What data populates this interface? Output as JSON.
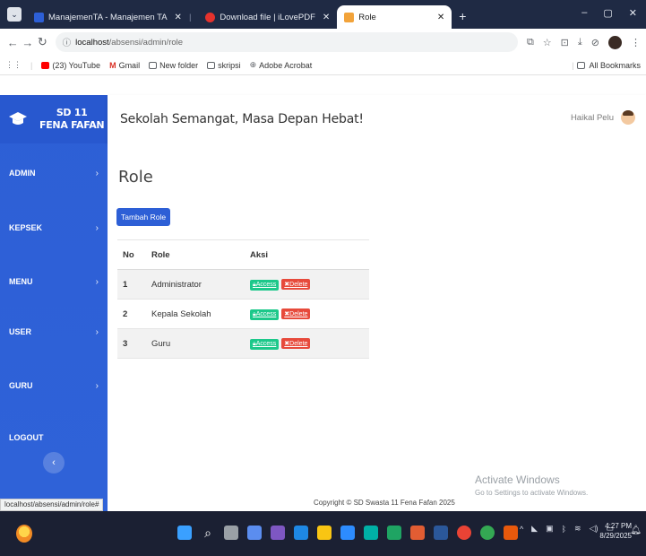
{
  "browser": {
    "tabs": [
      {
        "title": "ManajemenTA - Manajemen TA",
        "favicon_color": "#2d5fd6",
        "active": false
      },
      {
        "title": "Download file | iLovePDF",
        "favicon_color": "#e5322d",
        "active": false
      },
      {
        "title": "Role",
        "favicon_color": "#f2a33a",
        "active": true
      }
    ],
    "url_host": "localhost",
    "url_path": "/absensi/admin/role",
    "bookmarks": [
      {
        "label": "(23) YouTube",
        "icon_color": "#ff0000"
      },
      {
        "label": "Gmail",
        "icon_color": "#d93025"
      },
      {
        "label": "New folder",
        "icon_color": "#5f6368"
      },
      {
        "label": "skripsi",
        "icon_color": "#5f6368"
      },
      {
        "label": "Adobe Acrobat",
        "icon_color": "#5f6368"
      }
    ],
    "all_bookmarks": "All Bookmarks",
    "status_url": "localhost/absensi/admin/role#"
  },
  "sidebar": {
    "brand_line1": "SD 11",
    "brand_line2": "FENA FAFAN",
    "items": [
      {
        "label": "ADMIN",
        "has_chevron": true
      },
      {
        "label": "KEPSEK",
        "has_chevron": true
      },
      {
        "label": "MENU",
        "has_chevron": true
      },
      {
        "label": "USER",
        "has_chevron": true
      },
      {
        "label": "GURU",
        "has_chevron": true
      },
      {
        "label": "LOGOUT",
        "has_chevron": false
      }
    ],
    "toggle_label": "‹"
  },
  "topbar": {
    "motto": "Sekolah Semangat, Masa Depan Hebat!",
    "user_name": "Haikal Pelu"
  },
  "main": {
    "page_title": "Role",
    "add_button": "Tambah Role",
    "table": {
      "headers": [
        "No",
        "Role",
        "Aksi"
      ],
      "rows": [
        {
          "no": "1",
          "role": "Administrator",
          "access": "Access",
          "delete": "Delete"
        },
        {
          "no": "2",
          "role": "Kepala Sekolah",
          "access": "Access",
          "delete": "Delete"
        },
        {
          "no": "3",
          "role": "Guru",
          "access": "Access",
          "delete": "Delete"
        }
      ]
    },
    "footer": "Copyright © SD Swasta 11 Fena Fafan 2025",
    "watermark_title": "Activate Windows",
    "watermark_sub": "Go to Settings to activate Windows."
  },
  "taskbar": {
    "time": "4:27 PM",
    "date": "8/29/2025"
  },
  "colors": {
    "sidebar": "#2d5fd6",
    "access_button": "#1cc88a",
    "delete_button": "#e74a3b",
    "primary_button": "#2d5fd6"
  }
}
